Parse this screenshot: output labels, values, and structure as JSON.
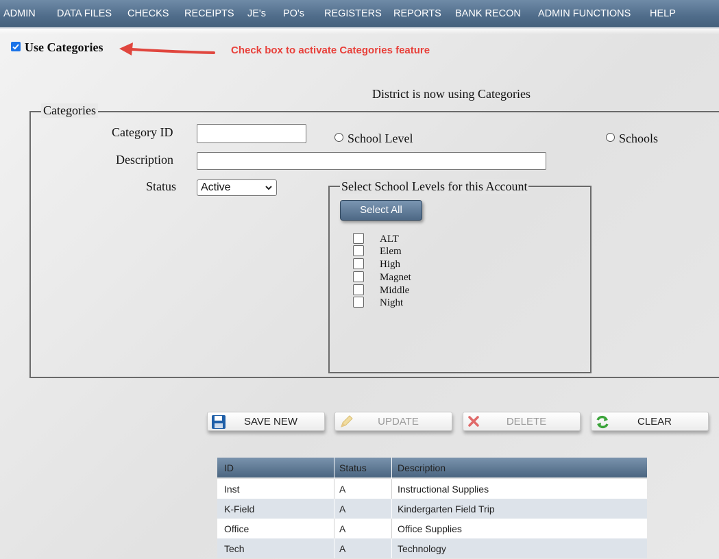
{
  "nav": {
    "items": [
      "ADMIN",
      "DATA FILES",
      "CHECKS",
      "RECEIPTS",
      "JE's",
      "PO's",
      "REGISTERS",
      "REPORTS",
      "BANK RECON",
      "ADMIN FUNCTIONS",
      "HELP"
    ]
  },
  "use_categories": {
    "label": "Use Categories",
    "checked": true,
    "annotation": "Check box to activate Categories feature"
  },
  "status_message": "District is now using Categories",
  "form": {
    "legend": "Categories",
    "category_id_label": "Category ID",
    "category_id_value": "",
    "description_label": "Description",
    "description_value": "",
    "status_label": "Status",
    "status_value": "Active",
    "radio_school_level": "School Level",
    "radio_schools": "Schools"
  },
  "school_levels": {
    "legend": "Select School Levels for this Account",
    "select_all_label": "Select All",
    "items": [
      "ALT",
      "Elem",
      "High",
      "Magnet",
      "Middle",
      "Night"
    ]
  },
  "actions": {
    "save_new": "SAVE NEW",
    "update": "UPDATE",
    "delete": "DELETE",
    "clear": "CLEAR"
  },
  "table": {
    "headers": [
      "ID",
      "Status",
      "Description"
    ],
    "rows": [
      [
        "Inst",
        "A",
        "Instructional Supplies"
      ],
      [
        "K-Field",
        "A",
        "Kindergarten Field Trip"
      ],
      [
        "Office",
        "A",
        "Office Supplies"
      ],
      [
        "Tech",
        "A",
        "Technology"
      ]
    ]
  },
  "colors": {
    "nav_bg": "#56728f",
    "annotation": "#e8413b",
    "row_alt": "#dde3ea"
  }
}
